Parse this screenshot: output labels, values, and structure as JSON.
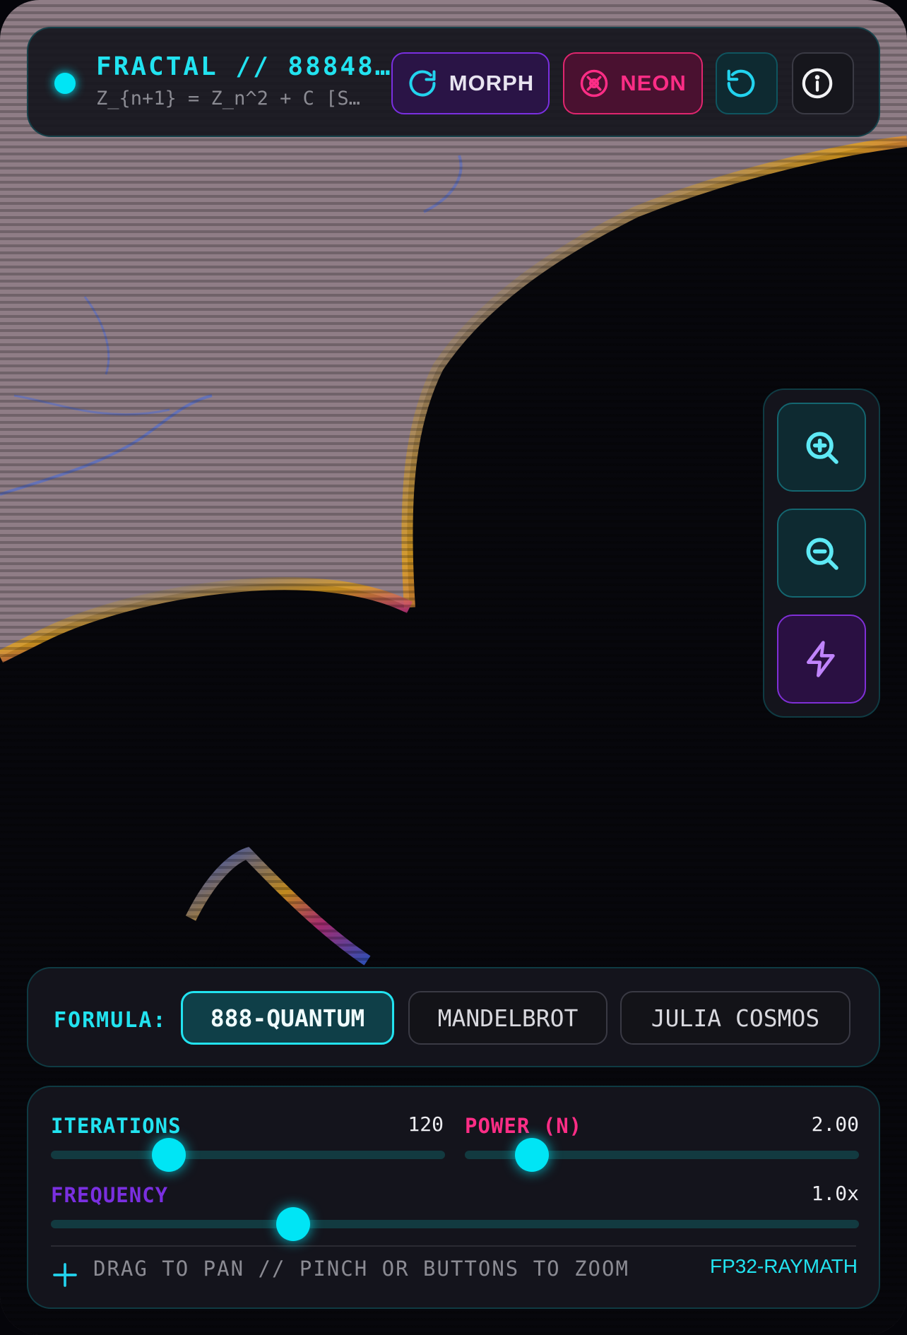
{
  "header": {
    "title": "FRACTAL // 88848…",
    "subtitle": "Z_{n+1} = Z_n^2 + C [S…",
    "morph_label": "MORPH",
    "neon_label": "NEON"
  },
  "formula": {
    "label": "FORMULA:",
    "options": [
      "888-QUANTUM",
      "MANDELBROT",
      "JULIA COSMOS"
    ],
    "selected": "888-QUANTUM"
  },
  "controls": {
    "iterations": {
      "label": "ITERATIONS",
      "value": "120",
      "fraction": 0.3
    },
    "power": {
      "label": "POWER (N)",
      "value": "2.00",
      "fraction": 0.17
    },
    "frequency": {
      "label": "FREQUENCY",
      "value": "1.0x",
      "fraction": 0.3
    }
  },
  "footer": {
    "hint": "DRAG TO PAN // PINCH OR BUTTONS TO ZOOM",
    "engine": "FP32-RAYMATH"
  },
  "colors": {
    "accent_cyan": "#22e3f0",
    "accent_magenta": "#ff2d86",
    "accent_purple": "#7a2fe0",
    "background": "#06060b"
  },
  "icons": [
    "live-dot",
    "refresh-icon",
    "aperture-icon",
    "reset-icon",
    "info-icon",
    "zoom-in-icon",
    "zoom-out-icon",
    "lightning-icon",
    "plus-icon"
  ]
}
